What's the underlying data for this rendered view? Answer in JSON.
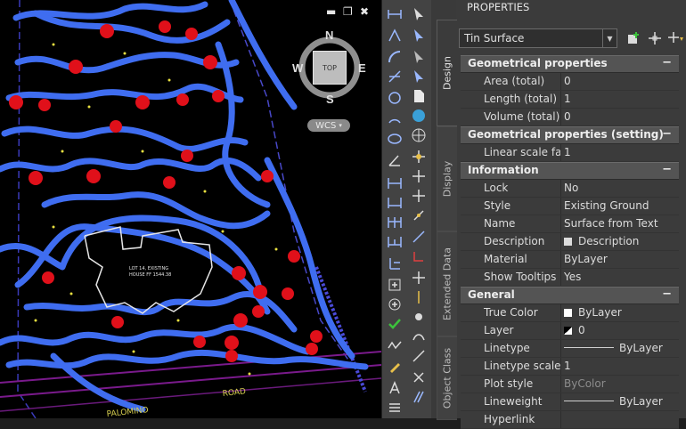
{
  "app": {
    "palette_title": "PROPERTIES"
  },
  "viewport": {
    "top_label": "TOP",
    "compass": {
      "n": "N",
      "s": "S",
      "e": "E",
      "w": "W"
    },
    "wcs": "WCS",
    "lot_note_1": "LOT 14, EXISTING",
    "lot_note_2": "HOUSE FF 1544.38",
    "road_1": "ROAD",
    "road_2": "PALOMINO",
    "controls": {
      "minimize": "▬",
      "restore": "❐",
      "close": "✖"
    }
  },
  "palette": {
    "tabs": [
      "Design",
      "Display",
      "Extended Data",
      "Object Class"
    ],
    "selector": {
      "value": "Tin Surface"
    },
    "sections": [
      {
        "title": "Geometrical properties",
        "rows": [
          {
            "label": "Area (total)",
            "value": "0"
          },
          {
            "label": "Length (total)",
            "value": "1"
          },
          {
            "label": "Volume (total)",
            "value": "0"
          }
        ]
      },
      {
        "title": "Geometrical properties (setting)",
        "rows": [
          {
            "label": "Linear scale fa...",
            "value": "1"
          }
        ]
      },
      {
        "title": "Information",
        "rows": [
          {
            "label": "Lock",
            "value": "No"
          },
          {
            "label": "Style",
            "value": "Existing Ground"
          },
          {
            "label": "Name",
            "value": "Surface from Text"
          },
          {
            "label": "Description",
            "value": "Description"
          },
          {
            "label": "Material",
            "value": "ByLayer"
          },
          {
            "label": "Show Tooltips",
            "value": "Yes"
          }
        ]
      },
      {
        "title": "General",
        "rows": [
          {
            "label": "True Color",
            "value": "ByLayer"
          },
          {
            "label": "Layer",
            "value": "0"
          },
          {
            "label": "Linetype",
            "value": "ByLayer"
          },
          {
            "label": "Linetype scale",
            "value": "1"
          },
          {
            "label": "Plot style",
            "value": "ByColor"
          },
          {
            "label": "Lineweight",
            "value": "ByLayer"
          },
          {
            "label": "Hyperlink",
            "value": ""
          }
        ]
      }
    ],
    "collapse_symbol": "−"
  },
  "colors": {
    "contour": "#3f6df0",
    "tree": "#e0101a",
    "background": "#000000",
    "panel": "#3b3b3b",
    "header": "#545454"
  },
  "icons": [
    "add-selection-icon",
    "pick-add-icon",
    "quick-select-icon"
  ]
}
